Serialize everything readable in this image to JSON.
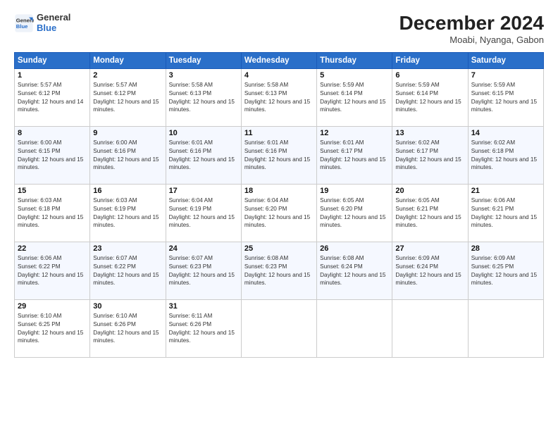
{
  "header": {
    "logo_line1": "General",
    "logo_line2": "Blue",
    "month": "December 2024",
    "location": "Moabi, Nyanga, Gabon"
  },
  "weekdays": [
    "Sunday",
    "Monday",
    "Tuesday",
    "Wednesday",
    "Thursday",
    "Friday",
    "Saturday"
  ],
  "weeks": [
    [
      {
        "day": "1",
        "rise": "5:57 AM",
        "set": "6:12 PM",
        "daylight": "12 hours and 14 minutes."
      },
      {
        "day": "2",
        "rise": "5:57 AM",
        "set": "6:12 PM",
        "daylight": "12 hours and 15 minutes."
      },
      {
        "day": "3",
        "rise": "5:58 AM",
        "set": "6:13 PM",
        "daylight": "12 hours and 15 minutes."
      },
      {
        "day": "4",
        "rise": "5:58 AM",
        "set": "6:13 PM",
        "daylight": "12 hours and 15 minutes."
      },
      {
        "day": "5",
        "rise": "5:59 AM",
        "set": "6:14 PM",
        "daylight": "12 hours and 15 minutes."
      },
      {
        "day": "6",
        "rise": "5:59 AM",
        "set": "6:14 PM",
        "daylight": "12 hours and 15 minutes."
      },
      {
        "day": "7",
        "rise": "5:59 AM",
        "set": "6:15 PM",
        "daylight": "12 hours and 15 minutes."
      }
    ],
    [
      {
        "day": "8",
        "rise": "6:00 AM",
        "set": "6:15 PM",
        "daylight": "12 hours and 15 minutes."
      },
      {
        "day": "9",
        "rise": "6:00 AM",
        "set": "6:16 PM",
        "daylight": "12 hours and 15 minutes."
      },
      {
        "day": "10",
        "rise": "6:01 AM",
        "set": "6:16 PM",
        "daylight": "12 hours and 15 minutes."
      },
      {
        "day": "11",
        "rise": "6:01 AM",
        "set": "6:16 PM",
        "daylight": "12 hours and 15 minutes."
      },
      {
        "day": "12",
        "rise": "6:01 AM",
        "set": "6:17 PM",
        "daylight": "12 hours and 15 minutes."
      },
      {
        "day": "13",
        "rise": "6:02 AM",
        "set": "6:17 PM",
        "daylight": "12 hours and 15 minutes."
      },
      {
        "day": "14",
        "rise": "6:02 AM",
        "set": "6:18 PM",
        "daylight": "12 hours and 15 minutes."
      }
    ],
    [
      {
        "day": "15",
        "rise": "6:03 AM",
        "set": "6:18 PM",
        "daylight": "12 hours and 15 minutes."
      },
      {
        "day": "16",
        "rise": "6:03 AM",
        "set": "6:19 PM",
        "daylight": "12 hours and 15 minutes."
      },
      {
        "day": "17",
        "rise": "6:04 AM",
        "set": "6:19 PM",
        "daylight": "12 hours and 15 minutes."
      },
      {
        "day": "18",
        "rise": "6:04 AM",
        "set": "6:20 PM",
        "daylight": "12 hours and 15 minutes."
      },
      {
        "day": "19",
        "rise": "6:05 AM",
        "set": "6:20 PM",
        "daylight": "12 hours and 15 minutes."
      },
      {
        "day": "20",
        "rise": "6:05 AM",
        "set": "6:21 PM",
        "daylight": "12 hours and 15 minutes."
      },
      {
        "day": "21",
        "rise": "6:06 AM",
        "set": "6:21 PM",
        "daylight": "12 hours and 15 minutes."
      }
    ],
    [
      {
        "day": "22",
        "rise": "6:06 AM",
        "set": "6:22 PM",
        "daylight": "12 hours and 15 minutes."
      },
      {
        "day": "23",
        "rise": "6:07 AM",
        "set": "6:22 PM",
        "daylight": "12 hours and 15 minutes."
      },
      {
        "day": "24",
        "rise": "6:07 AM",
        "set": "6:23 PM",
        "daylight": "12 hours and 15 minutes."
      },
      {
        "day": "25",
        "rise": "6:08 AM",
        "set": "6:23 PM",
        "daylight": "12 hours and 15 minutes."
      },
      {
        "day": "26",
        "rise": "6:08 AM",
        "set": "6:24 PM",
        "daylight": "12 hours and 15 minutes."
      },
      {
        "day": "27",
        "rise": "6:09 AM",
        "set": "6:24 PM",
        "daylight": "12 hours and 15 minutes."
      },
      {
        "day": "28",
        "rise": "6:09 AM",
        "set": "6:25 PM",
        "daylight": "12 hours and 15 minutes."
      }
    ],
    [
      {
        "day": "29",
        "rise": "6:10 AM",
        "set": "6:25 PM",
        "daylight": "12 hours and 15 minutes."
      },
      {
        "day": "30",
        "rise": "6:10 AM",
        "set": "6:26 PM",
        "daylight": "12 hours and 15 minutes."
      },
      {
        "day": "31",
        "rise": "6:11 AM",
        "set": "6:26 PM",
        "daylight": "12 hours and 15 minutes."
      },
      null,
      null,
      null,
      null
    ]
  ]
}
